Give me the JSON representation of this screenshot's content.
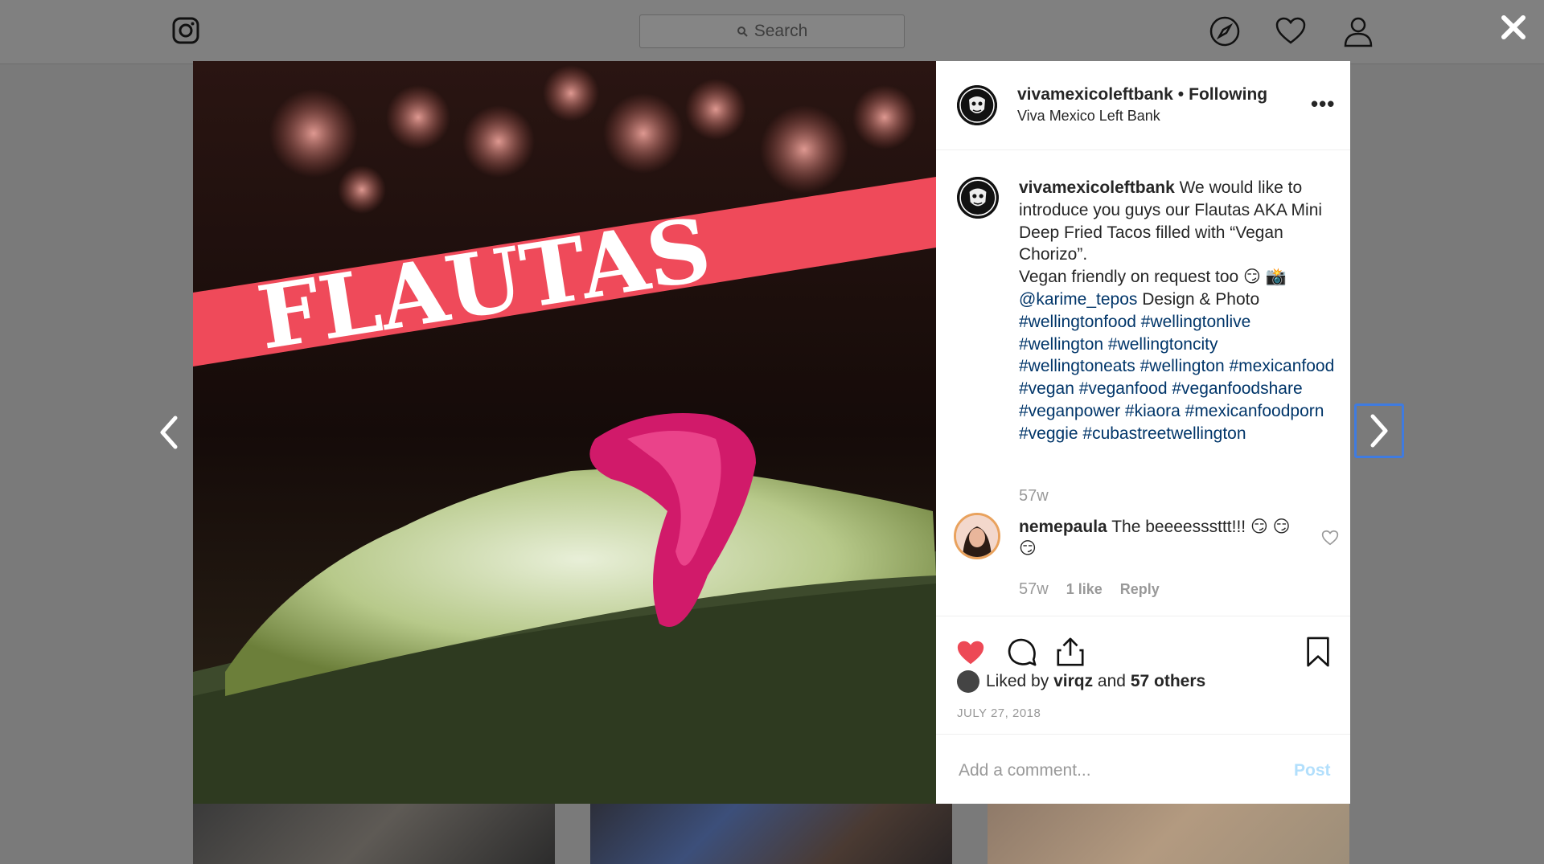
{
  "topbar": {
    "search_placeholder": "Search",
    "icons": [
      "instagram-logo-icon",
      "compass-icon",
      "heart-icon",
      "profile-icon",
      "close-icon"
    ]
  },
  "post": {
    "image_text": "FLAUTAS",
    "header": {
      "username": "vivamexicoleftbank",
      "dot": "•",
      "follow_status": "Following",
      "location": "Viva Mexico Left Bank"
    },
    "caption": {
      "username": "vivamexicoleftbank",
      "text": "We would like to introduce you guys our Flautas AKA Mini Deep Fried Tacos filled with “Vegan Chorizo”.",
      "line2": "Vegan friendly on request too 😏 📸",
      "mention": "@karime_tepos",
      "line3_rest": " Design & Photo",
      "hashtags": "#wellingtonfood #wellingtonlive #wellington #wellingtoncity #wellingtoneats #wellington #mexicanfood #vegan #veganfood #veganfoodshare #veganpower #kiaora #mexicanfoodporn #veggie #cubastreetwellington",
      "time": "57w"
    },
    "comments": [
      {
        "username": "nemepaula",
        "text": "The beeeesssttt!!! 😏 😏 😏",
        "time": "57w",
        "likes": "1 like",
        "reply": "Reply"
      }
    ],
    "likes": {
      "prefix": "Liked by",
      "user": "virqz",
      "middle": "and",
      "others": "57 others"
    },
    "date": "JULY 27, 2018",
    "comment_input_placeholder": "Add a comment...",
    "post_button": "Post"
  },
  "colors": {
    "like_red": "#ed4956",
    "hashtag_blue": "#003569",
    "post_disabled": "#b2dffc",
    "banner_red": "#ef4a5a"
  }
}
